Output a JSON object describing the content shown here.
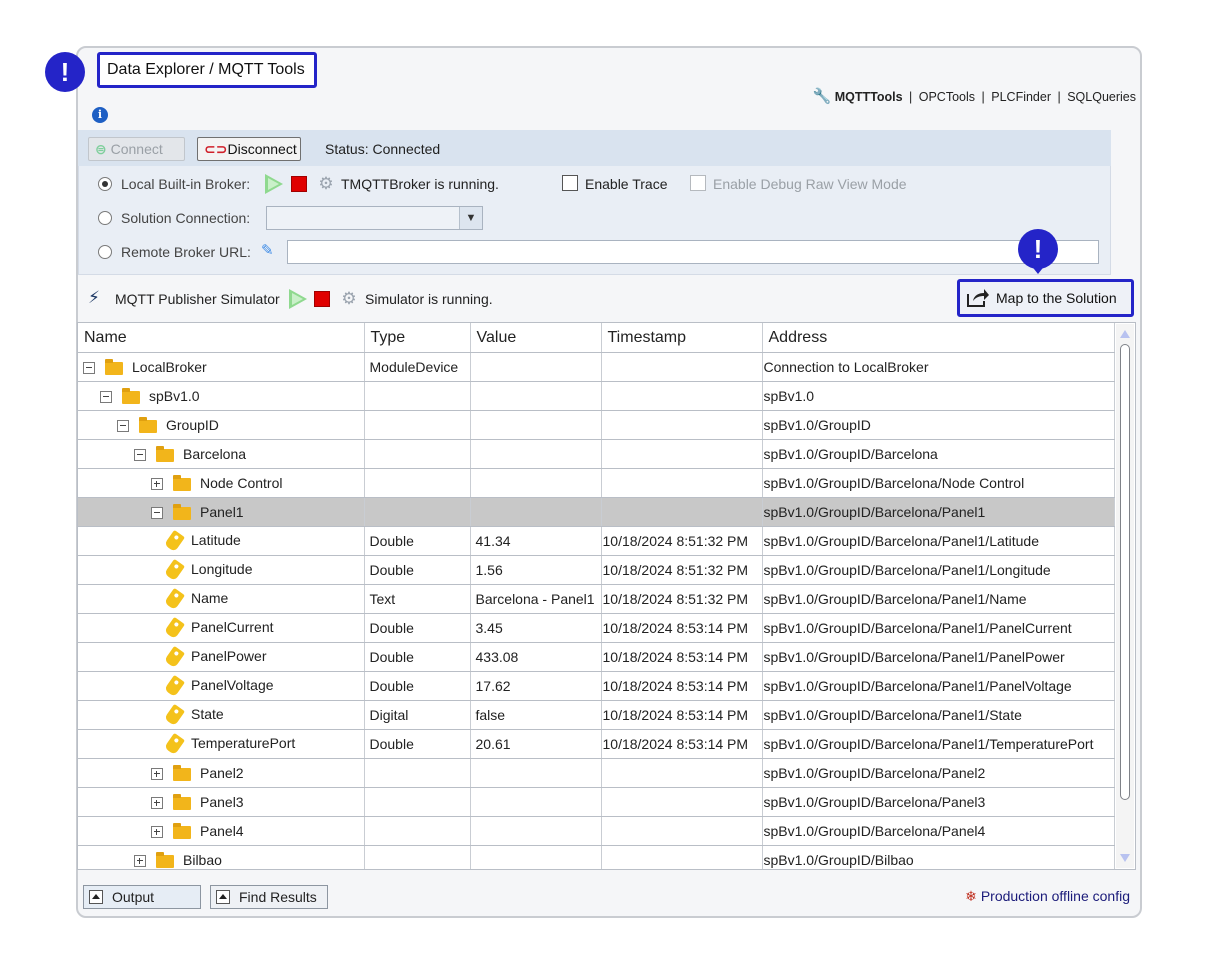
{
  "window": {
    "title": "Data Explorer / MQTT Tools"
  },
  "callouts": {
    "title_marker": "!",
    "map_marker": "!"
  },
  "tools_nav": {
    "active": "MQTTTools",
    "items": [
      "OPCTools",
      "PLCFinder",
      "SQLQueries"
    ],
    "separator": "|"
  },
  "info": {
    "glyph": "i"
  },
  "connection_toolbar": {
    "connect_label": "Connect",
    "disconnect_label": "Disconnect",
    "status": "Status: Connected"
  },
  "broker_options": {
    "local_label": "Local Built-in Broker:",
    "local_status": "TMQTTBroker is running.",
    "enable_trace_label": "Enable Trace",
    "debug_raw_label": "Enable Debug Raw View Mode",
    "solution_label": "Solution Connection:",
    "solution_value": "",
    "remote_label": "Remote Broker URL:",
    "remote_value": ""
  },
  "simulator": {
    "label": "MQTT Publisher Simulator",
    "status": "Simulator is running.",
    "map_button_label": "Map to the Solution"
  },
  "grid": {
    "columns": [
      "Name",
      "Type",
      "Value",
      "Timestamp",
      "Address"
    ],
    "rows": [
      {
        "level": 0,
        "kind": "folder",
        "expander": "minus",
        "name": "LocalBroker",
        "type": "ModuleDevice",
        "value": "",
        "timestamp": "",
        "address": "Connection to LocalBroker"
      },
      {
        "level": 1,
        "kind": "folder",
        "expander": "minus",
        "name": "spBv1.0",
        "type": "",
        "value": "",
        "timestamp": "",
        "address": "spBv1.0"
      },
      {
        "level": 2,
        "kind": "folder",
        "expander": "minus",
        "name": "GroupID",
        "type": "",
        "value": "",
        "timestamp": "",
        "address": "spBv1.0/GroupID"
      },
      {
        "level": 3,
        "kind": "folder",
        "expander": "minus",
        "name": "Barcelona",
        "type": "",
        "value": "",
        "timestamp": "",
        "address": "spBv1.0/GroupID/Barcelona"
      },
      {
        "level": 4,
        "kind": "folder",
        "expander": "plus",
        "name": "Node Control",
        "type": "",
        "value": "",
        "timestamp": "",
        "address": "spBv1.0/GroupID/Barcelona/Node Control"
      },
      {
        "level": 4,
        "kind": "folder",
        "expander": "minus",
        "name": "Panel1",
        "type": "",
        "value": "",
        "timestamp": "",
        "address": "spBv1.0/GroupID/Barcelona/Panel1",
        "selected": true
      },
      {
        "level": 5,
        "kind": "tag",
        "name": "Latitude",
        "type": "Double",
        "value": "41.34",
        "timestamp": "10/18/2024 8:51:32 PM",
        "address": "spBv1.0/GroupID/Barcelona/Panel1/Latitude"
      },
      {
        "level": 5,
        "kind": "tag",
        "name": "Longitude",
        "type": "Double",
        "value": "1.56",
        "timestamp": "10/18/2024 8:51:32 PM",
        "address": "spBv1.0/GroupID/Barcelona/Panel1/Longitude"
      },
      {
        "level": 5,
        "kind": "tag",
        "name": "Name",
        "type": "Text",
        "value": "Barcelona - Panel1",
        "timestamp": "10/18/2024 8:51:32 PM",
        "address": "spBv1.0/GroupID/Barcelona/Panel1/Name"
      },
      {
        "level": 5,
        "kind": "tag",
        "name": "PanelCurrent",
        "type": "Double",
        "value": "3.45",
        "timestamp": "10/18/2024 8:53:14 PM",
        "address": "spBv1.0/GroupID/Barcelona/Panel1/PanelCurrent"
      },
      {
        "level": 5,
        "kind": "tag",
        "name": "PanelPower",
        "type": "Double",
        "value": "433.08",
        "timestamp": "10/18/2024 8:53:14 PM",
        "address": "spBv1.0/GroupID/Barcelona/Panel1/PanelPower"
      },
      {
        "level": 5,
        "kind": "tag",
        "name": "PanelVoltage",
        "type": "Double",
        "value": "17.62",
        "timestamp": "10/18/2024 8:53:14 PM",
        "address": "spBv1.0/GroupID/Barcelona/Panel1/PanelVoltage"
      },
      {
        "level": 5,
        "kind": "tag",
        "name": "State",
        "type": "Digital",
        "value": "false",
        "timestamp": "10/18/2024 8:53:14 PM",
        "address": "spBv1.0/GroupID/Barcelona/Panel1/State"
      },
      {
        "level": 5,
        "kind": "tag",
        "name": "TemperaturePort",
        "type": "Double",
        "value": "20.61",
        "timestamp": "10/18/2024 8:53:14 PM",
        "address": "spBv1.0/GroupID/Barcelona/Panel1/TemperaturePort"
      },
      {
        "level": 4,
        "kind": "folder",
        "expander": "plus",
        "name": "Panel2",
        "type": "",
        "value": "",
        "timestamp": "",
        "address": "spBv1.0/GroupID/Barcelona/Panel2"
      },
      {
        "level": 4,
        "kind": "folder",
        "expander": "plus",
        "name": "Panel3",
        "type": "",
        "value": "",
        "timestamp": "",
        "address": "spBv1.0/GroupID/Barcelona/Panel3"
      },
      {
        "level": 4,
        "kind": "folder",
        "expander": "plus",
        "name": "Panel4",
        "type": "",
        "value": "",
        "timestamp": "",
        "address": "spBv1.0/GroupID/Barcelona/Panel4"
      },
      {
        "level": 3,
        "kind": "folder",
        "expander": "plus",
        "name": "Bilbao",
        "type": "",
        "value": "",
        "timestamp": "",
        "address": "spBv1.0/GroupID/Bilbao"
      }
    ]
  },
  "bottom_bar": {
    "output_label": "Output",
    "find_results_label": "Find Results",
    "status": "Production offline config"
  },
  "colors": {
    "accent": "#2424c8",
    "selected_row": "#c8c8c8",
    "status_text": "#1b1b7a",
    "stop": "#e00000",
    "play": "#8fd98f"
  }
}
